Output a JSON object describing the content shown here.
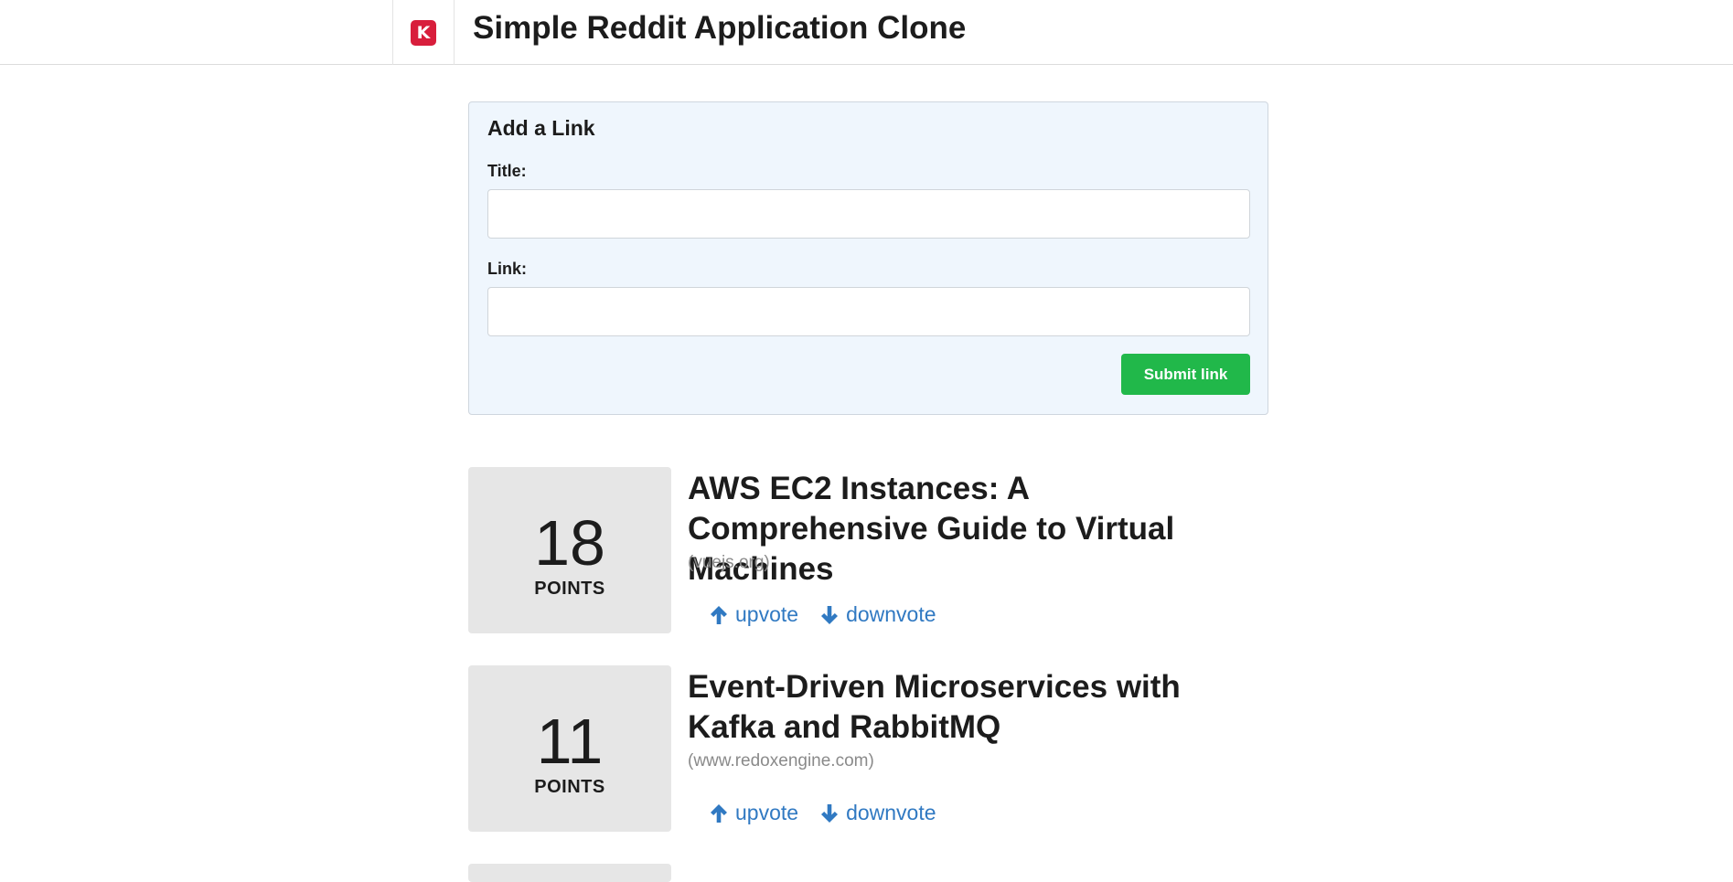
{
  "header": {
    "logo_letter": "K",
    "title": "Simple Reddit Application Clone",
    "logo_color": "#d81e3c"
  },
  "form": {
    "heading": "Add a Link",
    "title_label": "Title:",
    "title_value": "",
    "link_label": "Link:",
    "link_value": "",
    "submit_label": "Submit link",
    "submit_color": "#21b84a"
  },
  "posts": [
    {
      "points": "18",
      "points_label": "POINTS",
      "title": "AWS EC2 Instances: A Comprehensive Guide to Virtual Machines",
      "domain": "(vuejs.org)",
      "upvote": "upvote",
      "downvote": "downvote"
    },
    {
      "points": "11",
      "points_label": "POINTS",
      "title": "Event-Driven Microservices with Kafka and RabbitMQ",
      "domain": "(www.redoxengine.com)",
      "upvote": "upvote",
      "downvote": "downvote"
    }
  ],
  "icons": {
    "upvote": "arrow-up-icon",
    "downvote": "arrow-down-icon"
  },
  "link_color": "#3079c2"
}
